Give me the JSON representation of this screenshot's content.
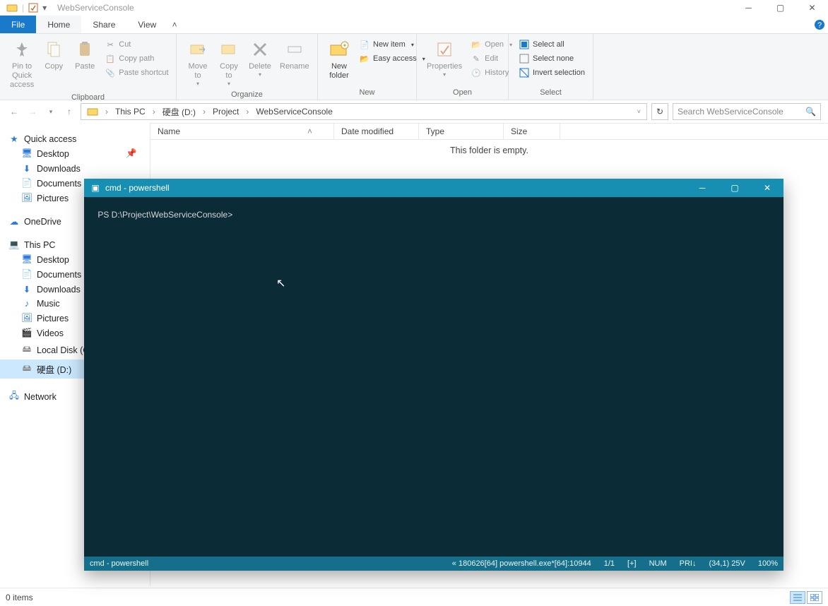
{
  "titlebar": {
    "title": "WebServiceConsole"
  },
  "tabs": {
    "file": "File",
    "home": "Home",
    "share": "Share",
    "view": "View"
  },
  "ribbon": {
    "pin": "Pin to Quick\naccess",
    "copy": "Copy",
    "paste": "Paste",
    "cut": "Cut",
    "copypath": "Copy path",
    "pasteshortcut": "Paste shortcut",
    "moveto": "Move\nto",
    "copyto": "Copy\nto",
    "delete": "Delete",
    "rename": "Rename",
    "newfolder": "New\nfolder",
    "newitem": "New item",
    "easyaccess": "Easy access",
    "properties": "Properties",
    "open": "Open",
    "edit": "Edit",
    "history": "History",
    "selectall": "Select all",
    "selectnone": "Select none",
    "invert": "Invert selection",
    "g_clipboard": "Clipboard",
    "g_organize": "Organize",
    "g_new": "New",
    "g_open": "Open",
    "g_select": "Select"
  },
  "crumbs": [
    "This PC",
    "硬盘 (D:)",
    "Project",
    "WebServiceConsole"
  ],
  "search_placeholder": "Search WebServiceConsole",
  "cols": {
    "name": "Name",
    "date": "Date modified",
    "type": "Type",
    "size": "Size"
  },
  "empty": "This folder is empty.",
  "sidebar": {
    "quick": "Quick access",
    "quick_items": [
      "Desktop",
      "Downloads",
      "Documents",
      "Pictures"
    ],
    "onedrive": "OneDrive",
    "thispc": "This PC",
    "pc_items": [
      "Desktop",
      "Documents",
      "Downloads",
      "Music",
      "Pictures",
      "Videos",
      "Local Disk (C:)",
      "硬盘 (D:)"
    ],
    "network": "Network"
  },
  "status": {
    "items": "0 items"
  },
  "term": {
    "title": "cmd - powershell",
    "prompt": "PS D:\\Project\\WebServiceConsole>",
    "sb_left": "cmd - powershell",
    "sb_right": [
      "« 180626[64]  powershell.exe*[64]:10944",
      "1/1",
      "[+]",
      "NUM",
      "PRI↓",
      "(34,1) 25V",
      "100%"
    ]
  }
}
